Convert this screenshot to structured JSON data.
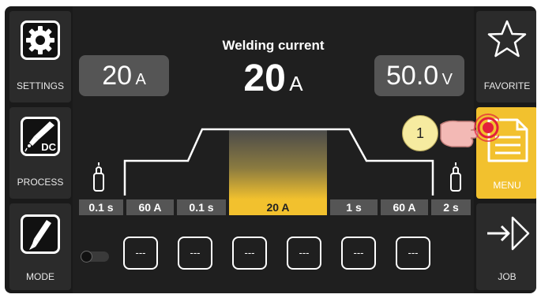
{
  "left_panel": {
    "settings_label": "SETTINGS",
    "process_label": "PROCESS",
    "process_badge": "DC",
    "mode_label": "MODE"
  },
  "right_panel": {
    "favorite_label": "FAVORITE",
    "menu_label": "MENU",
    "job_label": "JOB"
  },
  "header": {
    "title": "Welding current",
    "main_value": "20",
    "main_unit": "A",
    "left_value": "20",
    "left_unit": "A",
    "right_value": "50.0",
    "right_unit": "V"
  },
  "segments": [
    "0.1 s",
    "60 A",
    "0.1 s",
    "20 A",
    "1 s",
    "60 A",
    "2 s"
  ],
  "active_segment": "20 A",
  "callout": "1",
  "program_buttons": [
    "---",
    "---",
    "---",
    "---",
    "---",
    "---"
  ],
  "colors": {
    "accent": "#f2c12e",
    "background": "#1a1a1a",
    "panel": "#2b2b2b",
    "value_box": "#555555",
    "callout_bg": "#f6eba0",
    "touch_red": "#e3203c"
  }
}
